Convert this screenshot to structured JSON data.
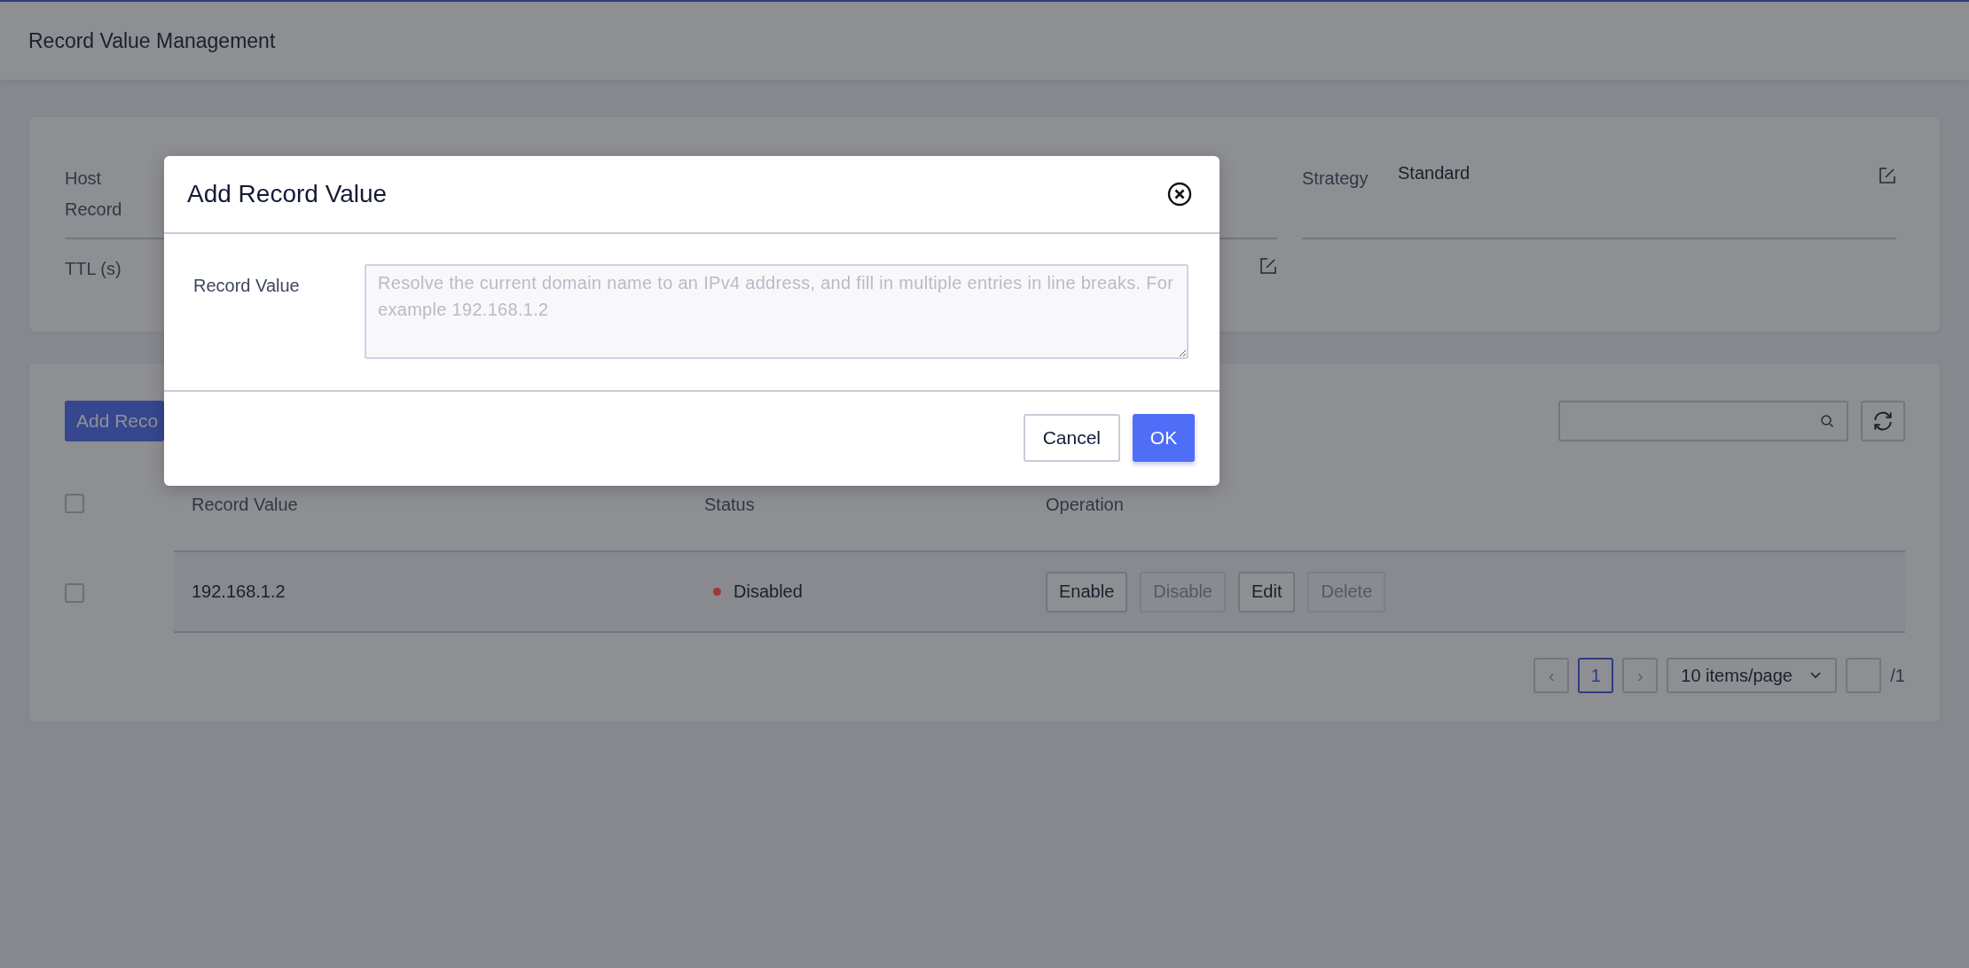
{
  "header": {
    "title": "Record Value Management"
  },
  "info": {
    "left_fields": [
      {
        "label": "Host Record",
        "edit_icon": false
      },
      {
        "label": "TTL (s)",
        "edit_icon": true
      }
    ],
    "right_fields": [
      {
        "label": "Strategy",
        "value": "Standard",
        "edit_icon": true
      }
    ]
  },
  "toolbar": {
    "add_button": "Add Reco"
  },
  "table": {
    "select_all": {
      "checked": false
    },
    "columns": [
      "Record Value",
      "Status",
      "Operation"
    ],
    "rows": [
      {
        "checked": false,
        "record_value": "192.168.1.2",
        "status": "Disabled",
        "color": "#9c3a30",
        "actions": [
          {
            "label": "Enable",
            "disabled": false
          },
          {
            "label": "Disable",
            "disabled": true
          },
          {
            "label": "Edit",
            "disabled": false
          },
          {
            "label": "Delete",
            "disabled": true
          }
        ]
      }
    ]
  },
  "pagination": {
    "prev": "‹",
    "pages": [
      {
        "label": "1",
        "selected": true
      }
    ],
    "next": "›",
    "page_size": "10 items/page",
    "total_pages": "/1"
  },
  "dialog": {
    "title": "Add Record Value",
    "field_label": "Record Value",
    "placeholder": "Resolve the current domain name to an IPv4 address, and fill in multiple entries in line breaks. For example 192.168.1.2",
    "cancel": "Cancel",
    "ok": "OK"
  }
}
